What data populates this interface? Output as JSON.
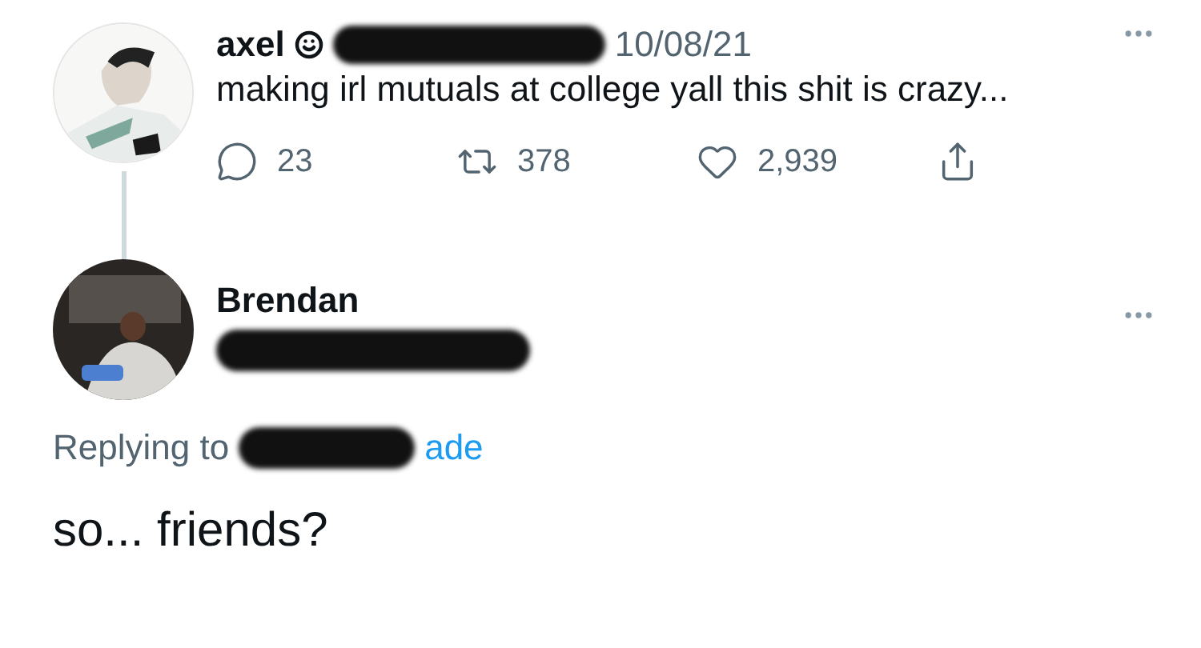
{
  "tweet": {
    "name": "axel",
    "date": "10/08/21",
    "text": "making irl mutuals at college yall this shit is crazy...",
    "actions": [
      {
        "kind": "reply",
        "count": "23"
      },
      {
        "kind": "retweet",
        "count": "378"
      },
      {
        "kind": "like",
        "count": "2,939"
      },
      {
        "kind": "share"
      }
    ]
  },
  "reply": {
    "name": "Brendan",
    "replying_label": "Replying to",
    "replying_link": "ade",
    "text": "so... friends?"
  }
}
